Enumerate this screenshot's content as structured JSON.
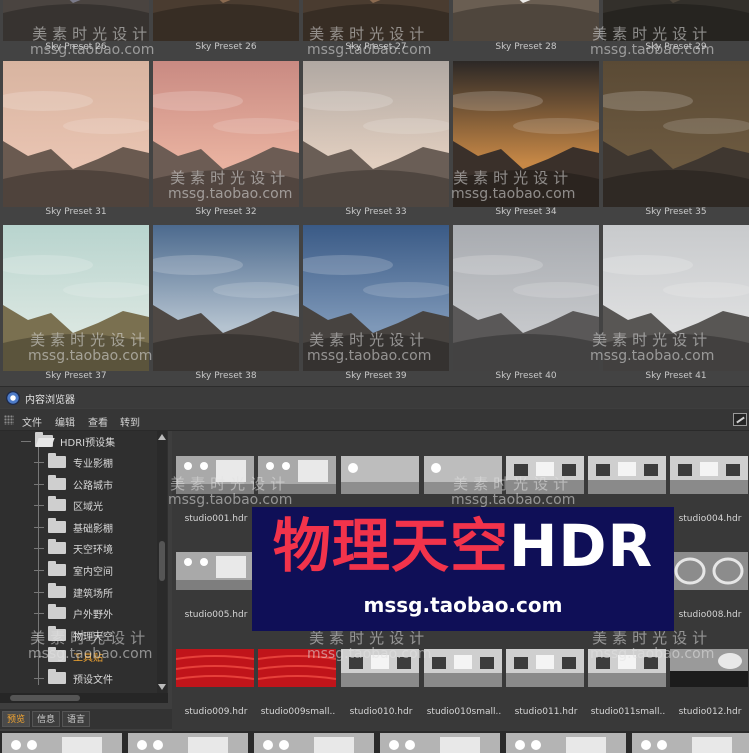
{
  "sky_presets": [
    {
      "label": "Sky Preset 26",
      "style": "dusk"
    },
    {
      "label": "Sky Preset 26",
      "style": "warm"
    },
    {
      "label": "Sky Preset 27",
      "style": "warm"
    },
    {
      "label": "Sky Preset 28",
      "style": "bright"
    },
    {
      "label": "Sky Preset 29",
      "style": "dark"
    },
    {
      "label": "Sky Preset 31",
      "style": "pink"
    },
    {
      "label": "Sky Preset 32",
      "style": "pink2"
    },
    {
      "label": "Sky Preset 33",
      "style": "pale"
    },
    {
      "label": "Sky Preset 34",
      "style": "sunset"
    },
    {
      "label": "Sky Preset 35",
      "style": "brown"
    },
    {
      "label": "Sky Preset 37",
      "style": "mint"
    },
    {
      "label": "Sky Preset 38",
      "style": "blue"
    },
    {
      "label": "Sky Preset 39",
      "style": "blue2"
    },
    {
      "label": "Sky Preset 40",
      "style": "grey"
    },
    {
      "label": "Sky Preset 41",
      "style": "light"
    }
  ],
  "content_browser": {
    "title": "内容浏览器",
    "menu": [
      "文件",
      "编辑",
      "查看",
      "转到"
    ]
  },
  "tree": {
    "root": "HDRI预设集",
    "items": [
      "专业影棚",
      "公路城市",
      "区域光",
      "基础影棚",
      "天空环境",
      "室内空间",
      "建筑场所",
      "户外野外",
      "物理天空",
      "工具贴",
      "预设文件"
    ],
    "selected_index": 9
  },
  "hdr_files": [
    {
      "label": "studio001.hdr",
      "style": "studio"
    },
    {
      "label": "",
      "style": "studio"
    },
    {
      "label": "",
      "style": "studio2"
    },
    {
      "label": "",
      "style": "studio2"
    },
    {
      "label": "",
      "style": "room"
    },
    {
      "label": "",
      "style": "room"
    },
    {
      "label": "studio004.hdr",
      "style": "room"
    },
    {
      "label": "studio005.hdr",
      "style": "studio"
    },
    {
      "label": "studio008.hdr",
      "style": "rings"
    },
    {
      "label": "studio009.hdr",
      "style": "red"
    },
    {
      "label": "studio009small..",
      "style": "red"
    },
    {
      "label": "studio010.hdr",
      "style": "room"
    },
    {
      "label": "studio010small..",
      "style": "room"
    },
    {
      "label": "studio011.hdr",
      "style": "room"
    },
    {
      "label": "studio011small..",
      "style": "room"
    },
    {
      "label": "studio012.hdr",
      "style": "dark"
    }
  ],
  "bottom_tabs": [
    "预览",
    "信息",
    "语言"
  ],
  "banner": {
    "title_cn": "物理天空",
    "title_en": "HDR",
    "subtitle": "mssg.taobao.com"
  },
  "watermark": {
    "cn": "美素时光设计",
    "url": "mssg.taobao.com"
  },
  "colors": {
    "accent_orange": "#f2a531",
    "banner_bg": "#0f0f57",
    "banner_red": "#f2334b"
  }
}
